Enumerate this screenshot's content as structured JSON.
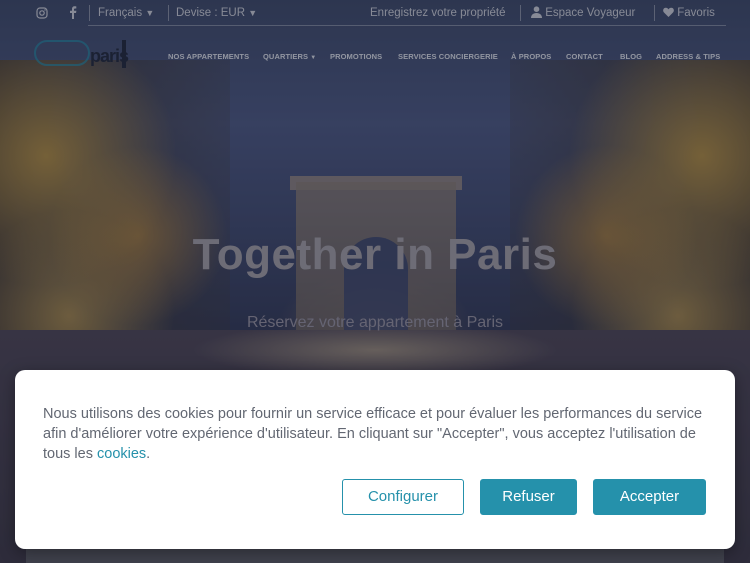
{
  "topbar": {
    "language": "Français",
    "currency": "Devise : EUR",
    "register": "Enregistrez votre propriété",
    "traveler_space": "Espace Voyageur",
    "favorites": "Favoris"
  },
  "logo": {
    "text": "paris"
  },
  "nav": {
    "items": [
      "NOS APPARTEMENTS",
      "QUARTIERS",
      "PROMOTIONS",
      "SERVICES CONCIERGERIE",
      "À PROPOS",
      "CONTACT",
      "BLOG",
      "ADDRESS & TIPS"
    ]
  },
  "hero": {
    "title": "Together in Paris",
    "subtitle": "Réservez votre appartement à Paris"
  },
  "cookie": {
    "text": "Nous utilisons des cookies pour fournir un service efficace et pour évaluer les performances du service afin d'améliorer votre expérience d'utilisateur. En cliquant sur \"Accepter\", vous acceptez l'utilisation de tous les ",
    "link": "cookies",
    "suffix": ".",
    "configure": "Configurer",
    "refuse": "Refuser",
    "accept": "Accepter",
    "accent_color": "#2591ab"
  }
}
